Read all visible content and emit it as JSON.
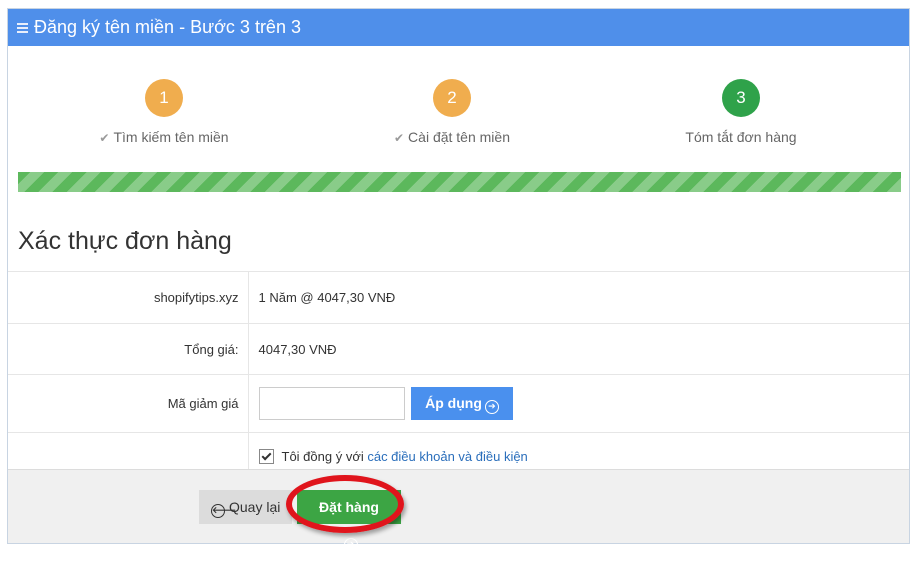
{
  "header": {
    "title": "Đăng ký tên miền - Bước 3 trên 3"
  },
  "steps": [
    {
      "num": "1",
      "label": "Tìm kiếm tên miền",
      "status": "done"
    },
    {
      "num": "2",
      "label": "Cài đặt tên miền",
      "status": "done"
    },
    {
      "num": "3",
      "label": "Tóm tắt đơn hàng",
      "status": "current"
    }
  ],
  "progress": {
    "percent": 100,
    "color": "#5cb85c"
  },
  "section": {
    "title": "Xác thực đơn hàng"
  },
  "order": {
    "domain": "shopifytips.xyz",
    "term": "1 Năm @ 4047,30 VNĐ",
    "total_label": "Tổng giá:",
    "total_value": "4047,30 VNĐ",
    "coupon_label": "Mã giảm giá",
    "coupon_value": "",
    "apply_label": "Áp dụng",
    "agree_text": "Tôi đồng ý với ",
    "terms_link": "các điều khoản và điều kiện",
    "agree_checked": true
  },
  "footer": {
    "back_label": "Quay lại",
    "order_label": "Đặt hàng"
  },
  "colors": {
    "header": "#4f8fea",
    "step_done": "#f0ad4e",
    "step_current": "#2fa24a",
    "apply_button": "#4a90ee",
    "order_button": "#3ca544",
    "highlight": "#e0141c"
  }
}
